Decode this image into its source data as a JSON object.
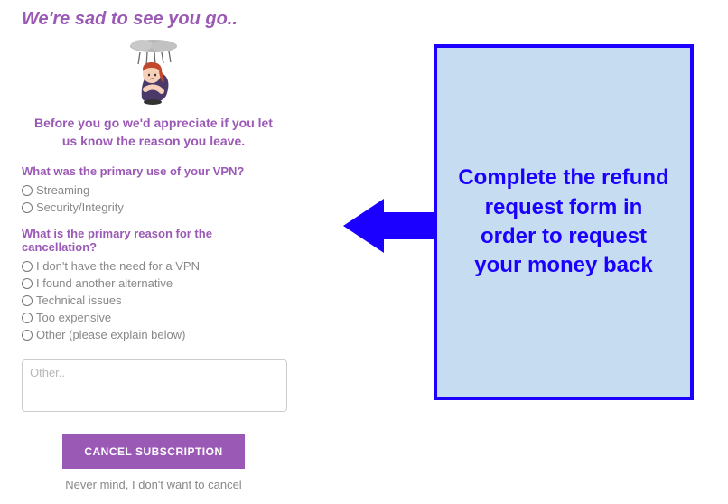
{
  "header": {
    "title": "We're sad to see you go..",
    "subhead": "Before you go we'd appreciate if you let us know the reason you leave."
  },
  "questions": {
    "q1": {
      "prompt": "What was the primary use of your VPN?",
      "options": [
        "Streaming",
        "Security/Integrity"
      ]
    },
    "q2": {
      "prompt": "What is the primary reason for the cancellation?",
      "options": [
        "I don't have the need for a VPN",
        "I found another alternative",
        "Technical issues",
        "Too expensive",
        "Other (please explain below)"
      ]
    }
  },
  "other_placeholder": "Other..",
  "buttons": {
    "cancel": "CANCEL SUBSCRIPTION",
    "nevermind": "Never mind, I don't want to cancel"
  },
  "callout": {
    "text": "Complete the refund request form in order to request your money back"
  },
  "colors": {
    "accent": "#9b59b6",
    "callout_border": "#1b00ff",
    "callout_bg": "#c6dcf0"
  }
}
